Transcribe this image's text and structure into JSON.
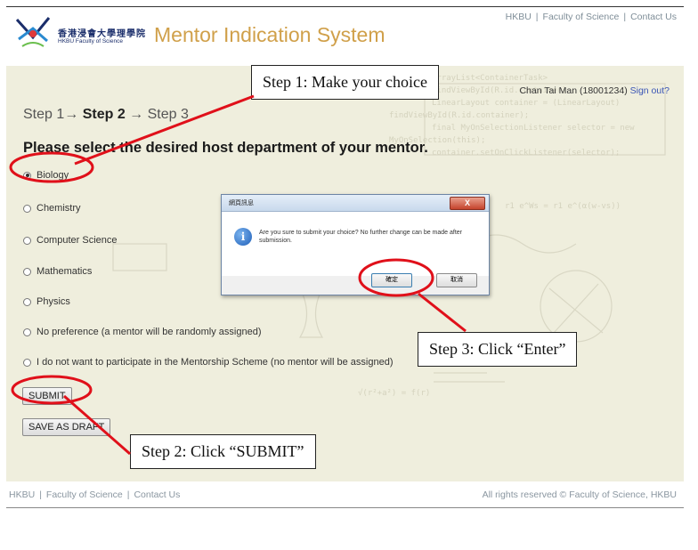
{
  "header": {
    "logo_zh": "香港浸會大學理學院",
    "logo_en": "HKBU Faculty of Science",
    "app_title": "Mentor Indication System",
    "links": [
      "HKBU",
      "Faculty of Science",
      "Contact Us"
    ]
  },
  "user": {
    "name": "Chan Tai Man (18001234)",
    "sign_out": "Sign out?"
  },
  "steps": {
    "step1": "Step 1→ ",
    "step2": "Step 2",
    "step3": " → Step 3"
  },
  "question": "Please select the desired host department of your mentor.",
  "options": [
    {
      "label": "Biology",
      "selected": true
    },
    {
      "label": "Chemistry",
      "selected": false
    },
    {
      "label": "Computer Science",
      "selected": false
    },
    {
      "label": "Mathematics",
      "selected": false
    },
    {
      "label": "Physics",
      "selected": false
    },
    {
      "label": "No preference (a mentor will be randomly assigned)",
      "selected": false
    },
    {
      "label": "I do not want to participate in the Mentorship Scheme (no mentor will be assigned)",
      "selected": false
    }
  ],
  "buttons": {
    "submit": "SUBMIT",
    "draft": "SAVE AS DRAFT"
  },
  "dialog": {
    "title": "網頁訊息",
    "message": "Are you sure to submit your choice? No further change can be made after submission.",
    "ok": "確定",
    "cancel": "取消",
    "close": "X"
  },
  "footer": {
    "links": [
      "HKBU",
      "Faculty of Science",
      "Contact Us"
    ],
    "copyright": "All rights reserved © Faculty of Science, HKBU"
  },
  "callouts": {
    "step1": "Step 1: Make your choice",
    "step2": "Step 2: Click “SUBMIT”",
    "step3": "Step 3: Click “Enter”"
  },
  "colors": {
    "accent_title": "#d0a04a",
    "annotation_red": "#e0101a",
    "content_bg": "#efeedd",
    "link_blue": "#3a55b5"
  }
}
